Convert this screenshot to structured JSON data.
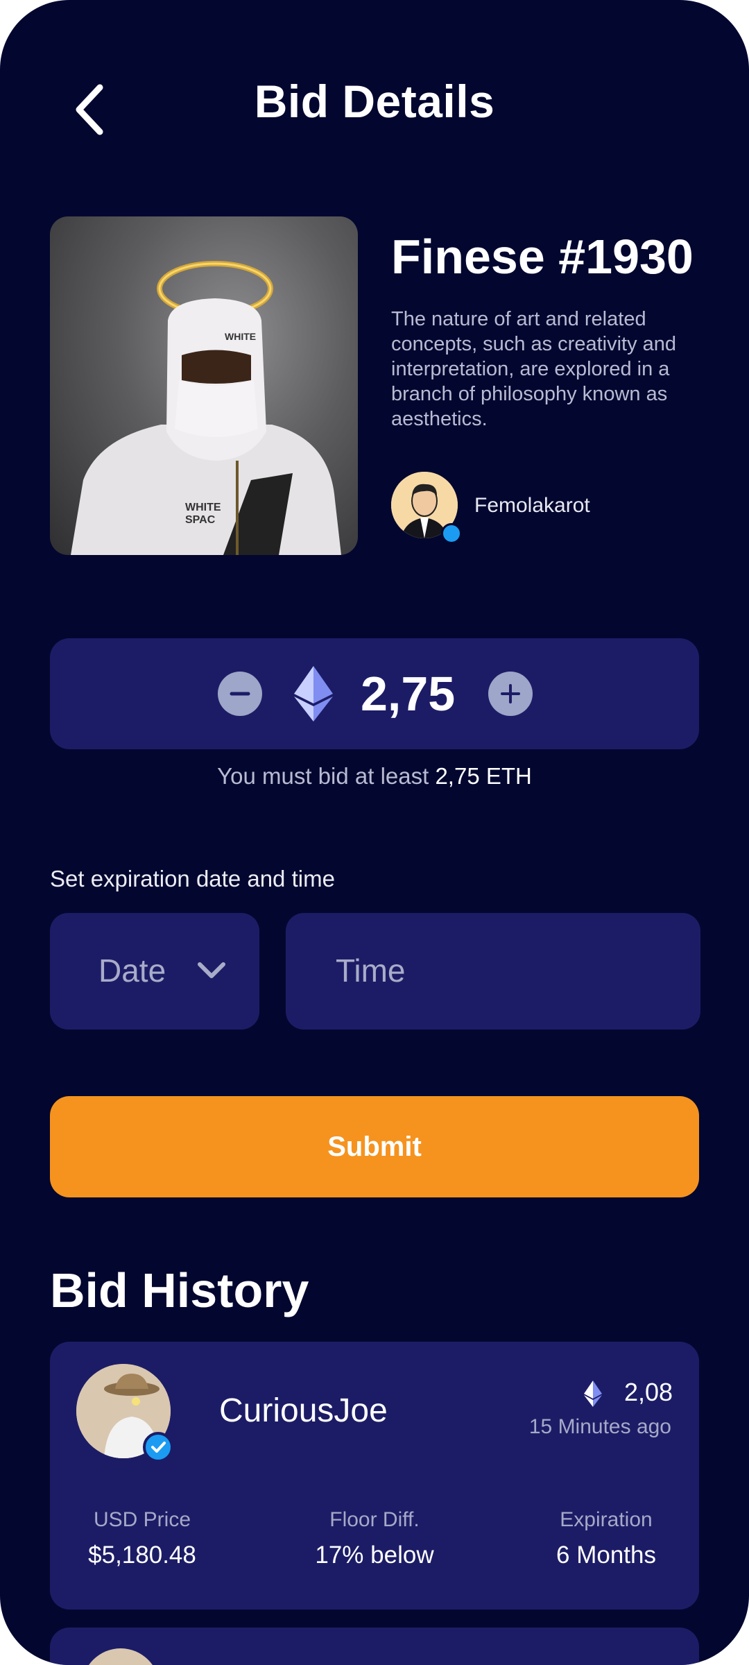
{
  "header": {
    "title": "Bid Details"
  },
  "nft": {
    "name": "Finese #1930",
    "description": "The nature of art and related concepts, such as creativity and interpretation, are explored in a branch of philosophy known as aesthetics.",
    "creator": "Femolakarot"
  },
  "bid": {
    "value": "2,75",
    "note_prefix": "You must bid at least ",
    "note_amount": "2,75 ETH"
  },
  "expiration": {
    "label": "Set expiration date and time",
    "date_placeholder": "Date",
    "time_placeholder": "Time"
  },
  "submit_label": "Submit",
  "history": {
    "title": "Bid History",
    "items": [
      {
        "bidder": "CuriousJoe",
        "amount": "2,08",
        "time": "15 Minutes ago",
        "usd_label": "USD Price",
        "usd_value": "$5,180.48",
        "floor_label": "Floor Diff.",
        "floor_value": "17% below",
        "exp_label": "Expiration",
        "exp_value": "6 Months"
      }
    ]
  },
  "colors": {
    "background": "#03072f",
    "card": "#1c1c66",
    "accent": "#f5931e",
    "verified": "#1b9cf2"
  },
  "icons": [
    "back-arrow-icon",
    "minus-icon",
    "plus-icon",
    "ethereum-icon",
    "chevron-down-icon",
    "verified-badge-icon"
  ]
}
